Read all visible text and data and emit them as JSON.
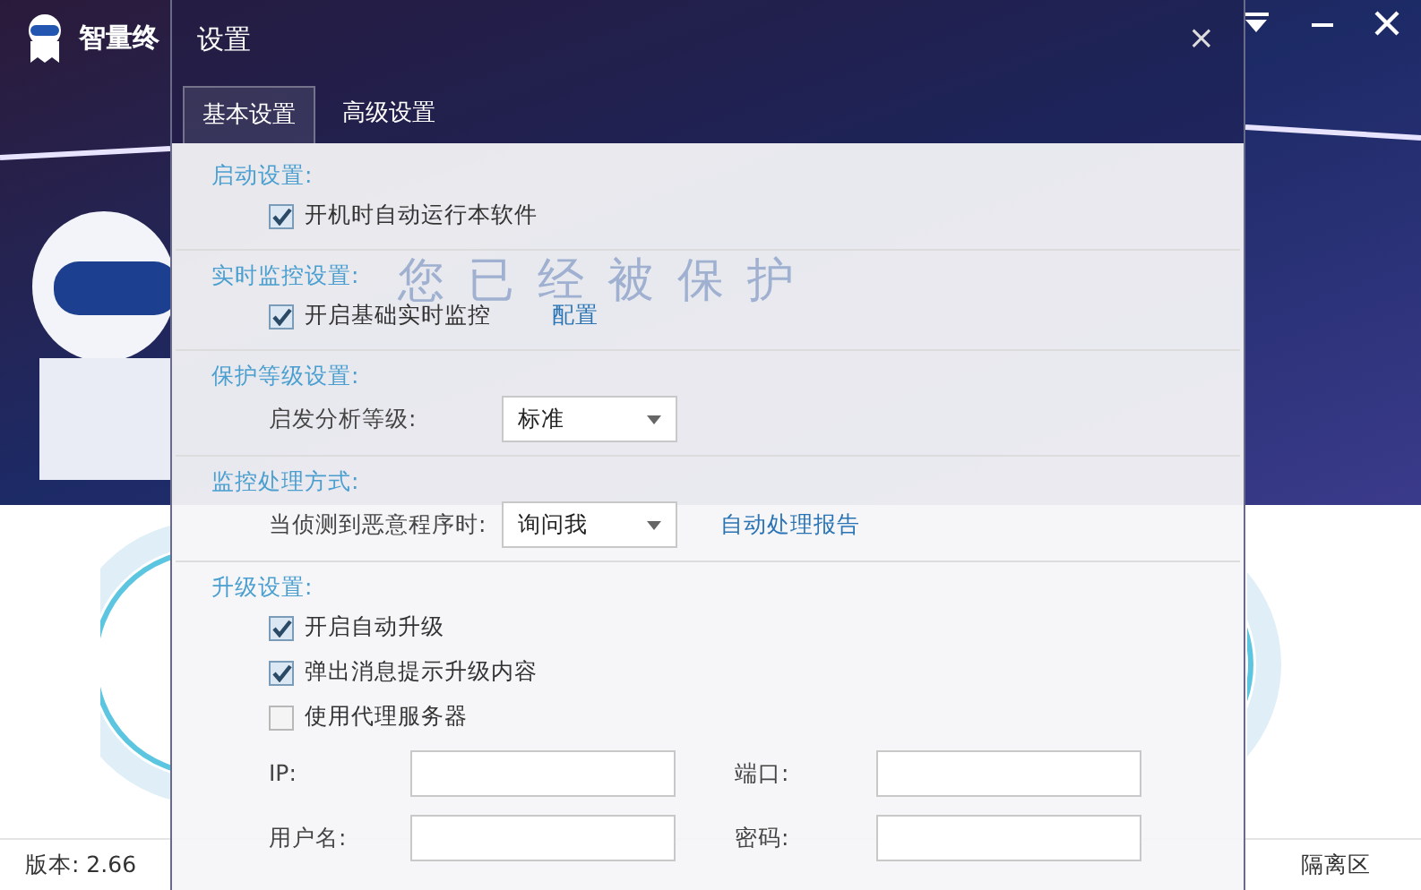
{
  "app": {
    "title": "智量终",
    "banner": "您已经被保护",
    "status_bar": {
      "version": "版本: 2.66",
      "quarantine": "隔离区"
    }
  },
  "dialog": {
    "title": "设置",
    "close": "×",
    "tabs": [
      {
        "label": "基本设置",
        "selected": true
      },
      {
        "label": "高级设置",
        "selected": false
      }
    ],
    "sections": [
      {
        "title": "启动设置:",
        "items": [
          {
            "kind": "checkbox",
            "label": "开机时自动运行本软件",
            "checked": true
          }
        ]
      },
      {
        "title": "实时监控设置:",
        "items": [
          {
            "kind": "checkbox",
            "label": "开启基础实时监控",
            "checked": true,
            "link": "配置"
          }
        ]
      },
      {
        "title": "保护等级设置:",
        "items": [
          {
            "kind": "select",
            "label": "启发分析等级:",
            "value": "标准"
          }
        ]
      },
      {
        "title": "监控处理方式:",
        "items": [
          {
            "kind": "select",
            "label": "当侦测到恶意程序时:",
            "value": "询问我",
            "link": "自动处理报告"
          }
        ]
      },
      {
        "title": "升级设置:",
        "items": [
          {
            "kind": "checkbox",
            "label": "开启自动升级",
            "checked": true
          },
          {
            "kind": "checkbox",
            "label": "弹出消息提示升级内容",
            "checked": true
          },
          {
            "kind": "checkbox",
            "label": "使用代理服务器",
            "checked": false
          },
          {
            "kind": "fields",
            "fields": [
              {
                "label": "IP:"
              },
              {
                "label": "端口:"
              }
            ]
          },
          {
            "kind": "fields",
            "fields": [
              {
                "label": "用户名:"
              },
              {
                "label": "密码:"
              }
            ]
          }
        ]
      }
    ]
  }
}
